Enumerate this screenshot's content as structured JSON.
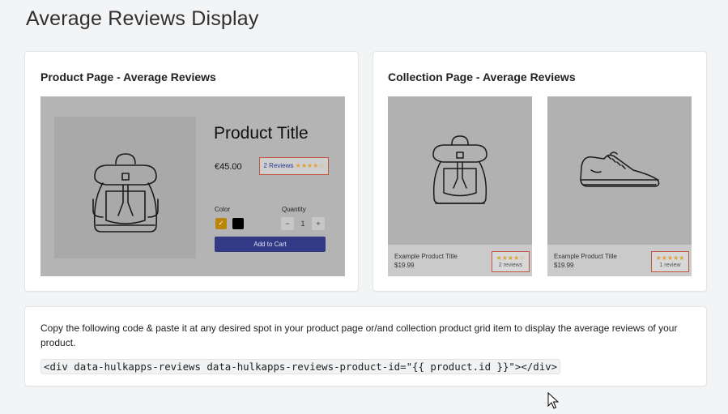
{
  "page": {
    "title": "Average Reviews Display"
  },
  "product_card": {
    "title": "Product Page - Average Reviews",
    "product_title": "Product Title",
    "price": "€45.00",
    "reviews_badge": {
      "label": "2 Reviews",
      "stars": "★★★★☆"
    },
    "color_label": "Color",
    "color_check": "✓",
    "quantity_label": "Quantity",
    "qty_minus": "−",
    "qty_value": "1",
    "qty_plus": "+",
    "add_to_cart": "Add to Cart",
    "colors": {
      "accent": "#323a86",
      "badge_border": "#c0573d",
      "stars": "#e0a13a",
      "swatch_gold": "#b8860b"
    }
  },
  "collection_card": {
    "title": "Collection Page - Average Reviews",
    "items": [
      {
        "name": "Example Product Title",
        "price": "$19.99",
        "stars": "★★★★☆",
        "count": "2 reviews",
        "icon": "backpack-icon"
      },
      {
        "name": "Example Product Title",
        "price": "$19.99",
        "stars": "★★★★★",
        "count": "1 review",
        "icon": "sneaker-icon"
      }
    ]
  },
  "code_card": {
    "instructions": "Copy the following code & paste it at any desired spot in your product page or/and collection product grid item to display the average reviews of your product.",
    "snippet": "<div data-hulkapps-reviews data-hulkapps-reviews-product-id=\"{{ product.id }}\"></div>"
  }
}
